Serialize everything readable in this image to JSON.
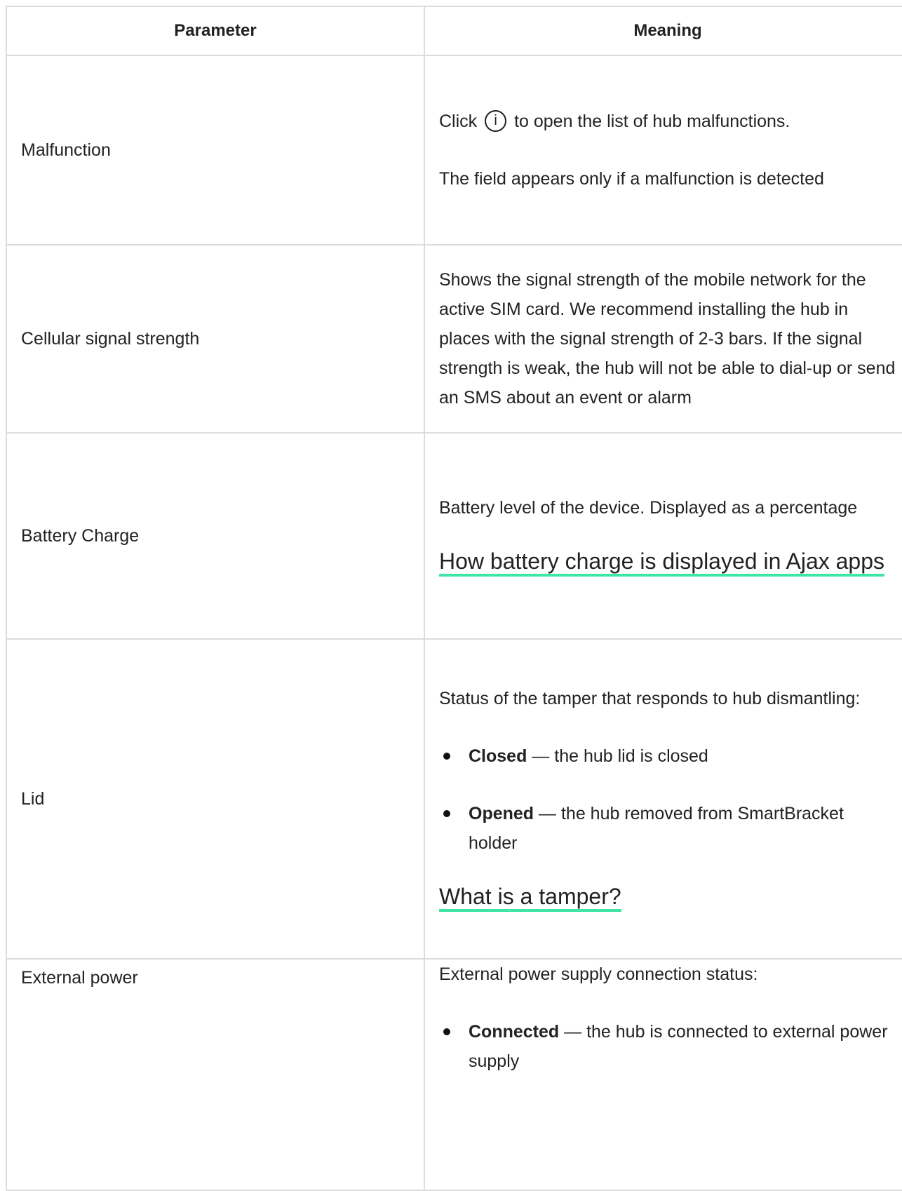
{
  "table": {
    "headers": {
      "parameter": "Parameter",
      "meaning": "Meaning"
    },
    "rows": [
      {
        "parameter": "Malfunction",
        "line1_before": "Click",
        "icon": "info-icon",
        "icon_glyph": "i",
        "line1_after": "to open the list of hub malfunctions.",
        "line2": "The field appears only if a malfunction is detected"
      },
      {
        "parameter": "Cellular signal strength",
        "text": "Shows the signal strength of the mobile network for the active SIM card. We recommend installing the hub in places with the signal strength of 2-3 bars. If the signal strength is weak, the hub will not be able to dial-up or send an SMS about an event or alarm"
      },
      {
        "parameter": "Battery Charge",
        "text": "Battery level of the device. Displayed as a percentage",
        "link": "How battery charge is displayed in Ajax apps"
      },
      {
        "parameter": "Lid",
        "text": "Status of the tamper that responds to hub dismantling:",
        "items": [
          {
            "term": "Closed",
            "desc": " — the hub lid is closed"
          },
          {
            "term": "Opened",
            "desc": " — the hub removed from SmartBracket holder"
          }
        ],
        "link": "What is a tamper?"
      },
      {
        "parameter": "External power",
        "text": "External power supply connection status:",
        "items": [
          {
            "term": "Connected",
            "desc": " — the hub is connected to external power supply"
          }
        ]
      }
    ]
  },
  "colors": {
    "link_underline": "#3ee5a4",
    "border": "#dcdcdc",
    "text": "#222222"
  }
}
